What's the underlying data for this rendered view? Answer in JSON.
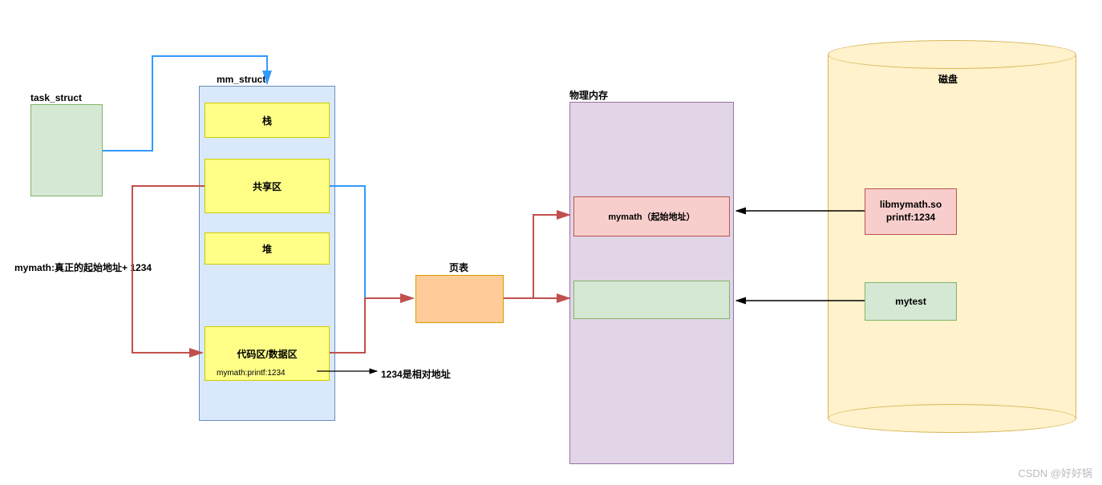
{
  "labels": {
    "task_struct": "task_struct",
    "mm_struct": "mm_struct",
    "stack": "栈",
    "shared": "共享区",
    "heap": "堆",
    "code_data": "代码区/数据区",
    "mymath_printf": "mymath:printf:1234",
    "rel_addr_note": "1234是相对地址",
    "mymath_real_note": "mymath:真正的起始地址+ 1234",
    "page_table": "页表",
    "phys_mem_title": "物理内存",
    "mymath_start": "mymath（起始地址）",
    "disk_title": "磁盘",
    "lib_line1": "libmymath.so",
    "lib_line2": "printf:1234",
    "mytest": "mytest",
    "watermark": "CSDN @好好锅"
  },
  "colors": {
    "task_fill": "#d5e8d4",
    "task_stroke": "#82b366",
    "mm_fill": "#dae8fc",
    "mm_stroke": "#6c8ebf",
    "yellow_fill": "#ffff88",
    "yellow_stroke": "#cccc00",
    "page_fill": "#ffcc99",
    "page_stroke": "#d79b00",
    "phys_fill": "#e1d5e7",
    "phys_stroke": "#9673a6",
    "red_fill": "#f8cecc",
    "red_stroke": "#b85450",
    "green_fill": "#d5e8d4",
    "green_stroke": "#82b366",
    "disk_fill": "#fff2cc",
    "disk_stroke": "#d6b656",
    "arrow_blue": "#3399ff",
    "arrow_red": "#c0504d",
    "arrow_black": "#000000"
  }
}
